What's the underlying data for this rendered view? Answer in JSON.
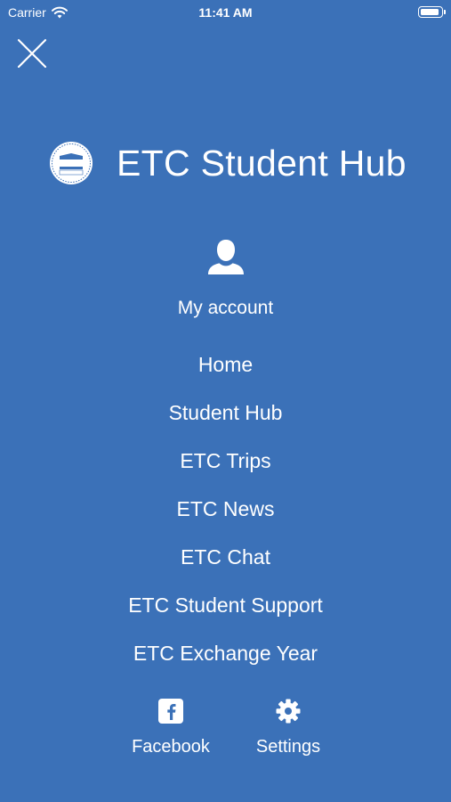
{
  "status_bar": {
    "carrier": "Carrier",
    "time": "11:41 AM",
    "battery_level": 0.95
  },
  "brand": {
    "title": "ETC Student Hub",
    "logo_text": "Education Welfare"
  },
  "account": {
    "label": "My account"
  },
  "menu": {
    "items": [
      {
        "label": "Home"
      },
      {
        "label": "Student Hub"
      },
      {
        "label": "ETC Trips"
      },
      {
        "label": "ETC News"
      },
      {
        "label": "ETC Chat"
      },
      {
        "label": "ETC Student Support"
      },
      {
        "label": "ETC Exchange Year"
      }
    ]
  },
  "footer": {
    "facebook_label": "Facebook",
    "settings_label": "Settings"
  },
  "colors": {
    "background": "#3b71b8",
    "foreground": "#ffffff"
  },
  "icons": [
    "wifi-icon",
    "battery-icon",
    "close-icon",
    "logo-icon",
    "account-icon",
    "facebook-icon",
    "gear-icon"
  ]
}
